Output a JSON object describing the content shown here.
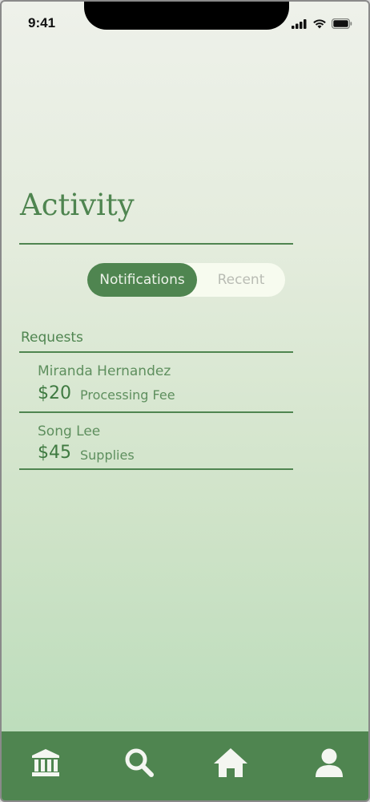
{
  "status_bar": {
    "time": "9:41",
    "icons": [
      "signal-icon",
      "wifi-icon",
      "battery-icon"
    ]
  },
  "page": {
    "title": "Activity"
  },
  "segmented_control": {
    "options": [
      {
        "label": "Notifications",
        "selected": true
      },
      {
        "label": "Recent",
        "selected": false
      }
    ]
  },
  "requests": {
    "heading": "Requests",
    "items": [
      {
        "name": "Miranda Hernandez",
        "amount": "$20",
        "description": "Processing Fee"
      },
      {
        "name": "Song Lee",
        "amount": "$45",
        "description": "Supplies"
      }
    ]
  },
  "tab_bar": {
    "items": [
      "bank-icon",
      "search-icon",
      "home-icon",
      "profile-icon"
    ]
  },
  "colors": {
    "accent": "#4f8550",
    "inactive_text": "#b9bcb4",
    "gradient_top": "#eef1ea",
    "gradient_bottom": "#b7dbb8"
  }
}
